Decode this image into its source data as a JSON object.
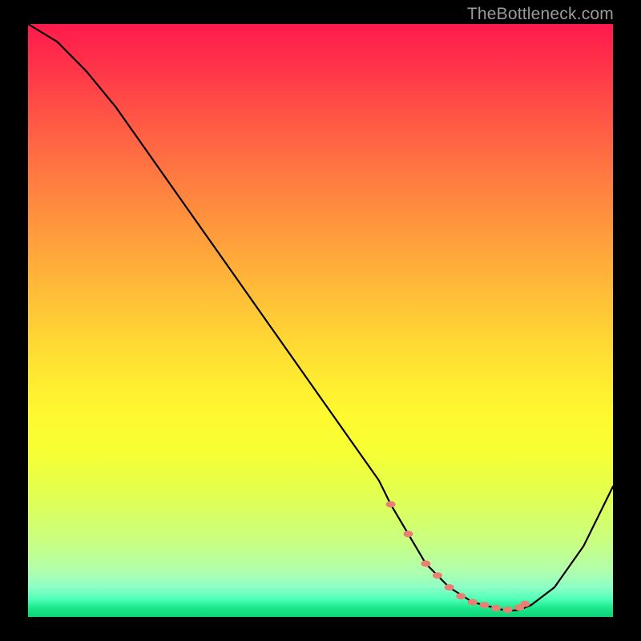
{
  "watermark": "TheBottleneck.com",
  "chart_data": {
    "type": "line",
    "title": "",
    "xlabel": "",
    "ylabel": "",
    "xlim": [
      0,
      100
    ],
    "ylim": [
      0,
      100
    ],
    "grid": false,
    "series": [
      {
        "name": "bottleneck-curve",
        "x": [
          0,
          5,
          10,
          15,
          20,
          25,
          30,
          35,
          40,
          45,
          50,
          55,
          60,
          62,
          65,
          68,
          72,
          76,
          80,
          82,
          84,
          86,
          90,
          95,
          100
        ],
        "y": [
          100,
          97,
          92,
          86,
          79,
          72,
          65,
          58,
          51,
          44,
          37,
          30,
          23,
          19,
          14,
          9,
          5,
          2.5,
          1.5,
          1,
          1.2,
          2,
          5,
          12,
          22
        ]
      },
      {
        "name": "highlight-dots",
        "x": [
          62,
          65,
          68,
          70,
          72,
          74,
          76,
          78,
          80,
          82,
          84,
          85
        ],
        "y": [
          19,
          14,
          9,
          7,
          5,
          3.5,
          2.5,
          2,
          1.5,
          1.2,
          1.6,
          2.2
        ]
      }
    ],
    "colors": {
      "curve_stroke": "#000000",
      "dot_fill": "#e98074",
      "background_top": "#ff1a4d",
      "background_bottom": "#0fd175"
    }
  }
}
